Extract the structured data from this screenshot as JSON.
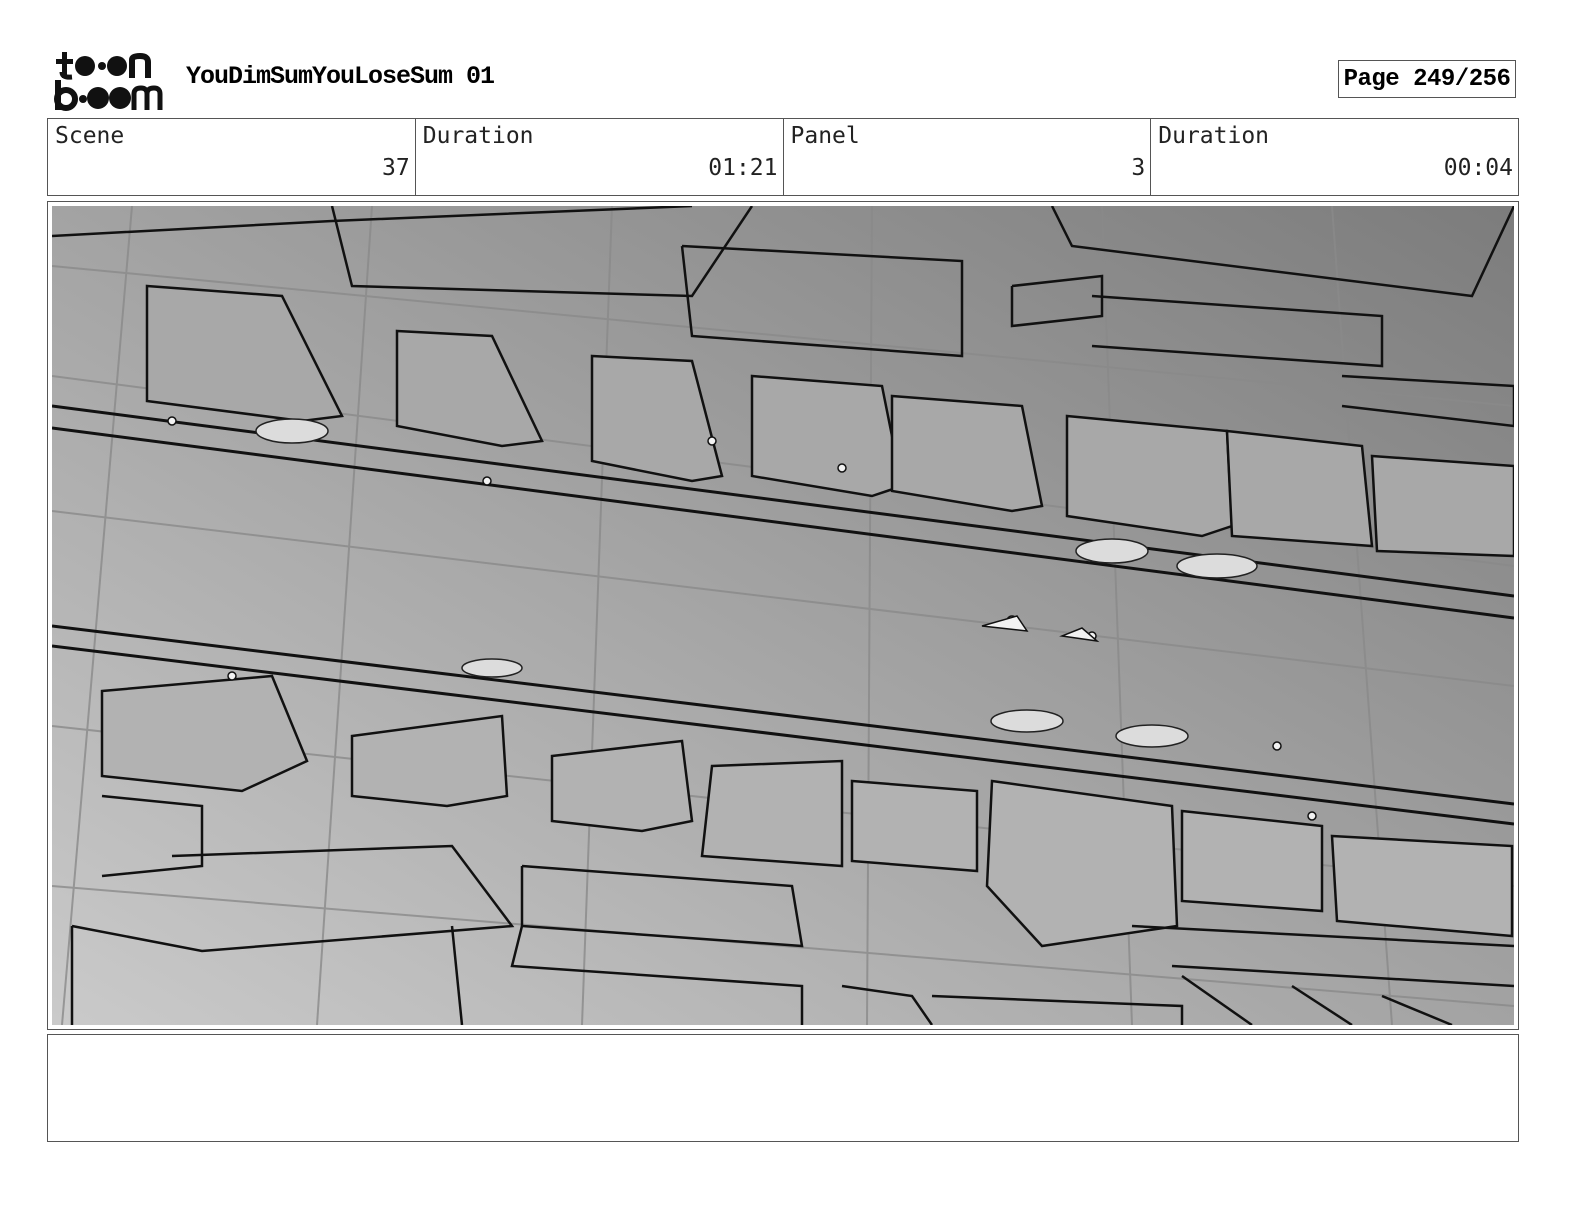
{
  "header": {
    "logo_icon": "toonboom-logo-icon",
    "title": "YouDimSumYouLoseSum 01",
    "page": "Page 249/256"
  },
  "info": {
    "scene_label": "Scene",
    "scene_value": "37",
    "scene_duration_label": "Duration",
    "scene_duration_value": "01:21",
    "panel_label": "Panel",
    "panel_value": "3",
    "panel_duration_label": "Duration",
    "panel_duration_value": "00:04"
  },
  "panel": {
    "image": "storyboard-sketch-aerial-street-view",
    "colors": {
      "gradient_light": "#c9c9c9",
      "gradient_dark": "#7e7e7e",
      "line": "#111111"
    }
  },
  "notes": {
    "text": ""
  }
}
